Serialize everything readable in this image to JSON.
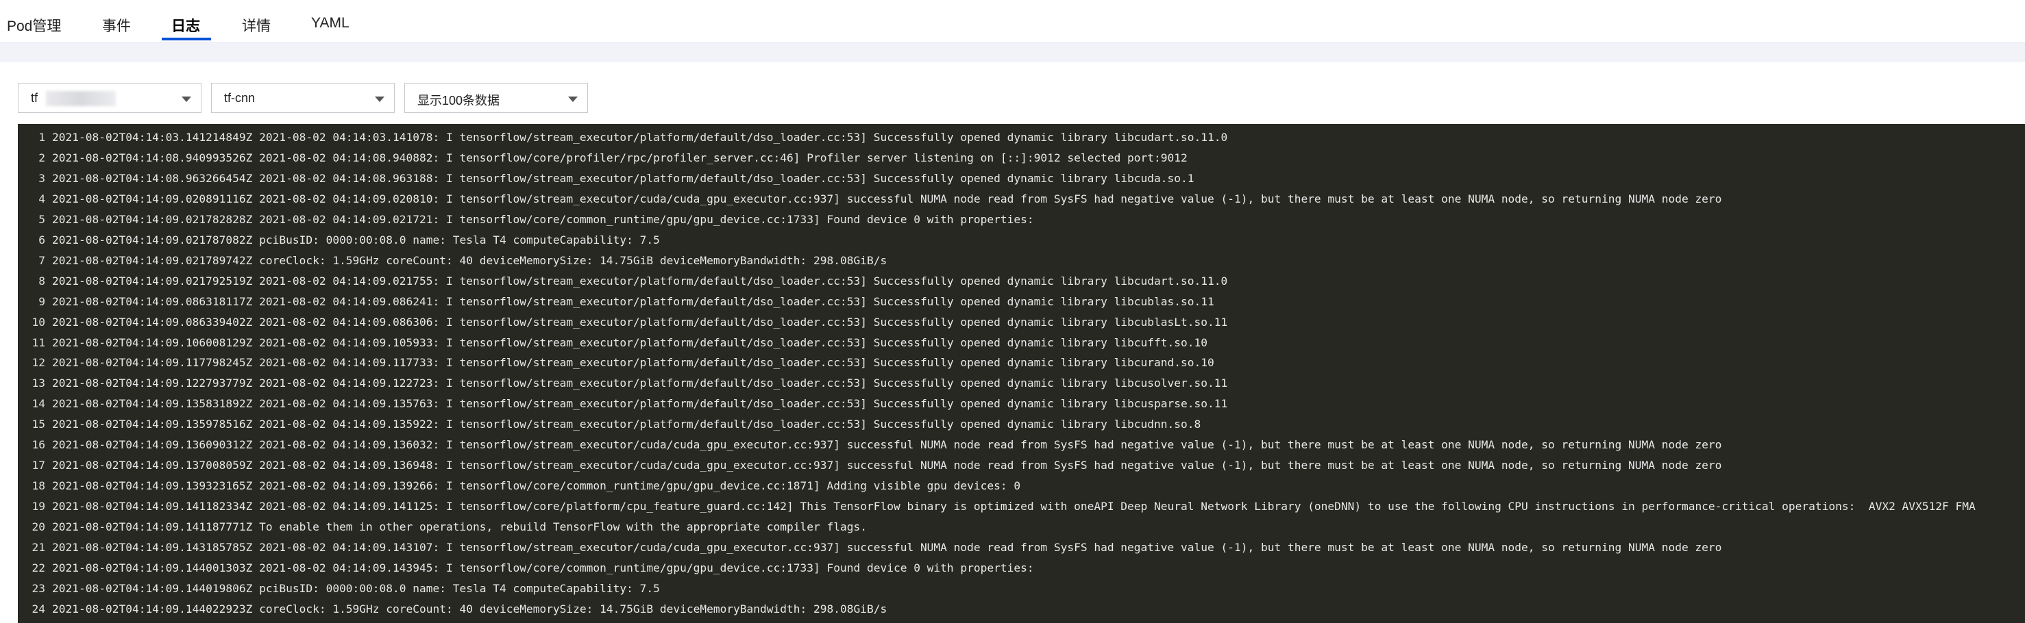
{
  "tabs": [
    {
      "label": "Pod管理",
      "active": false
    },
    {
      "label": "事件",
      "active": false
    },
    {
      "label": "日志",
      "active": true
    },
    {
      "label": "详情",
      "active": false
    },
    {
      "label": "YAML",
      "active": false
    }
  ],
  "filters": {
    "pod_select": {
      "value": "tf"
    },
    "container_select": {
      "value": "tf-cnn"
    },
    "limit_select": {
      "value": "显示100条数据"
    }
  },
  "colors": {
    "accent": "#0052d9",
    "log_background": "#272822",
    "log_text": "#e8e8e8"
  },
  "log_lines": [
    {
      "n": "1",
      "text": "2021-08-02T04:14:03.141214849Z 2021-08-02 04:14:03.141078: I tensorflow/stream_executor/platform/default/dso_loader.cc:53] Successfully opened dynamic library libcudart.so.11.0"
    },
    {
      "n": "2",
      "text": "2021-08-02T04:14:08.940993526Z 2021-08-02 04:14:08.940882: I tensorflow/core/profiler/rpc/profiler_server.cc:46] Profiler server listening on [::]:9012 selected port:9012"
    },
    {
      "n": "3",
      "text": "2021-08-02T04:14:08.963266454Z 2021-08-02 04:14:08.963188: I tensorflow/stream_executor/platform/default/dso_loader.cc:53] Successfully opened dynamic library libcuda.so.1"
    },
    {
      "n": "4",
      "text": "2021-08-02T04:14:09.020891116Z 2021-08-02 04:14:09.020810: I tensorflow/stream_executor/cuda/cuda_gpu_executor.cc:937] successful NUMA node read from SysFS had negative value (-1), but there must be at least one NUMA node, so returning NUMA node zero"
    },
    {
      "n": "5",
      "text": "2021-08-02T04:14:09.021782828Z 2021-08-02 04:14:09.021721: I tensorflow/core/common_runtime/gpu/gpu_device.cc:1733] Found device 0 with properties:"
    },
    {
      "n": "6",
      "text": "2021-08-02T04:14:09.021787082Z pciBusID: 0000:00:08.0 name: Tesla T4 computeCapability: 7.5"
    },
    {
      "n": "7",
      "text": "2021-08-02T04:14:09.021789742Z coreClock: 1.59GHz coreCount: 40 deviceMemorySize: 14.75GiB deviceMemoryBandwidth: 298.08GiB/s"
    },
    {
      "n": "8",
      "text": "2021-08-02T04:14:09.021792519Z 2021-08-02 04:14:09.021755: I tensorflow/stream_executor/platform/default/dso_loader.cc:53] Successfully opened dynamic library libcudart.so.11.0"
    },
    {
      "n": "9",
      "text": "2021-08-02T04:14:09.086318117Z 2021-08-02 04:14:09.086241: I tensorflow/stream_executor/platform/default/dso_loader.cc:53] Successfully opened dynamic library libcublas.so.11"
    },
    {
      "n": "10",
      "text": "2021-08-02T04:14:09.086339402Z 2021-08-02 04:14:09.086306: I tensorflow/stream_executor/platform/default/dso_loader.cc:53] Successfully opened dynamic library libcublasLt.so.11"
    },
    {
      "n": "11",
      "text": "2021-08-02T04:14:09.106008129Z 2021-08-02 04:14:09.105933: I tensorflow/stream_executor/platform/default/dso_loader.cc:53] Successfully opened dynamic library libcufft.so.10"
    },
    {
      "n": "12",
      "text": "2021-08-02T04:14:09.117798245Z 2021-08-02 04:14:09.117733: I tensorflow/stream_executor/platform/default/dso_loader.cc:53] Successfully opened dynamic library libcurand.so.10"
    },
    {
      "n": "13",
      "text": "2021-08-02T04:14:09.122793779Z 2021-08-02 04:14:09.122723: I tensorflow/stream_executor/platform/default/dso_loader.cc:53] Successfully opened dynamic library libcusolver.so.11"
    },
    {
      "n": "14",
      "text": "2021-08-02T04:14:09.135831892Z 2021-08-02 04:14:09.135763: I tensorflow/stream_executor/platform/default/dso_loader.cc:53] Successfully opened dynamic library libcusparse.so.11"
    },
    {
      "n": "15",
      "text": "2021-08-02T04:14:09.135978516Z 2021-08-02 04:14:09.135922: I tensorflow/stream_executor/platform/default/dso_loader.cc:53] Successfully opened dynamic library libcudnn.so.8"
    },
    {
      "n": "16",
      "text": "2021-08-02T04:14:09.136090312Z 2021-08-02 04:14:09.136032: I tensorflow/stream_executor/cuda/cuda_gpu_executor.cc:937] successful NUMA node read from SysFS had negative value (-1), but there must be at least one NUMA node, so returning NUMA node zero"
    },
    {
      "n": "17",
      "text": "2021-08-02T04:14:09.137008059Z 2021-08-02 04:14:09.136948: I tensorflow/stream_executor/cuda/cuda_gpu_executor.cc:937] successful NUMA node read from SysFS had negative value (-1), but there must be at least one NUMA node, so returning NUMA node zero"
    },
    {
      "n": "18",
      "text": "2021-08-02T04:14:09.139323165Z 2021-08-02 04:14:09.139266: I tensorflow/core/common_runtime/gpu/gpu_device.cc:1871] Adding visible gpu devices: 0"
    },
    {
      "n": "19",
      "text": "2021-08-02T04:14:09.141182334Z 2021-08-02 04:14:09.141125: I tensorflow/core/platform/cpu_feature_guard.cc:142] This TensorFlow binary is optimized with oneAPI Deep Neural Network Library (oneDNN) to use the following CPU instructions in performance-critical operations:  AVX2 AVX512F FMA"
    },
    {
      "n": "20",
      "text": "2021-08-02T04:14:09.141187771Z To enable them in other operations, rebuild TensorFlow with the appropriate compiler flags."
    },
    {
      "n": "21",
      "text": "2021-08-02T04:14:09.143185785Z 2021-08-02 04:14:09.143107: I tensorflow/stream_executor/cuda/cuda_gpu_executor.cc:937] successful NUMA node read from SysFS had negative value (-1), but there must be at least one NUMA node, so returning NUMA node zero"
    },
    {
      "n": "22",
      "text": "2021-08-02T04:14:09.144001303Z 2021-08-02 04:14:09.143945: I tensorflow/core/common_runtime/gpu/gpu_device.cc:1733] Found device 0 with properties:"
    },
    {
      "n": "23",
      "text": "2021-08-02T04:14:09.144019806Z pciBusID: 0000:00:08.0 name: Tesla T4 computeCapability: 7.5"
    },
    {
      "n": "24",
      "text": "2021-08-02T04:14:09.144022923Z coreClock: 1.59GHz coreCount: 40 deviceMemorySize: 14.75GiB deviceMemoryBandwidth: 298.08GiB/s"
    }
  ]
}
